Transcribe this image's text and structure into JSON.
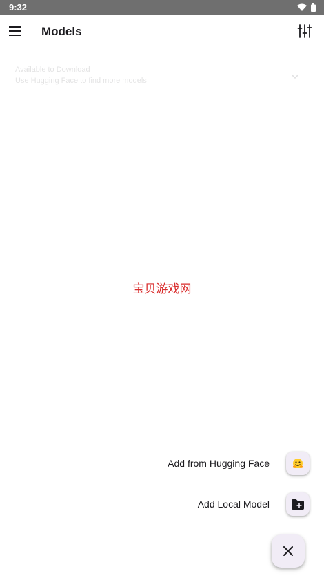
{
  "status_bar": {
    "time": "9:32",
    "icons": [
      "wifi-icon",
      "battery-icon"
    ]
  },
  "app_bar": {
    "title": "Models",
    "menu_icon": "hamburger-menu-icon",
    "filter_icon": "tune-icon"
  },
  "faded_card": {
    "line1": "Available to Download",
    "line2": "Use Hugging Face to find more models"
  },
  "watermark": "宝贝游戏网",
  "fab_menu": {
    "items": [
      {
        "label": "Add from Hugging Face",
        "icon": "hugging-face-icon"
      },
      {
        "label": "Add Local Model",
        "icon": "folder-add-icon"
      }
    ],
    "close_icon": "close-icon"
  },
  "colors": {
    "status_bar": "#6f6f6f",
    "fab_background": "#f1ecf6",
    "watermark": "#d92b2b",
    "text": "#1c1b1f"
  }
}
